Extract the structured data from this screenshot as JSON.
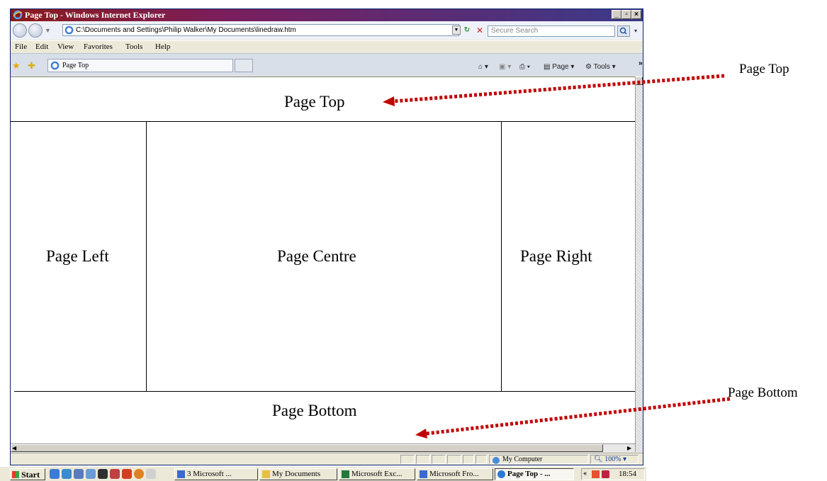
{
  "window": {
    "title": "Page Top - Windows Internet Explorer",
    "min": "_",
    "max": "▫",
    "close": "×"
  },
  "address": {
    "url": "C:\\Documents and Settings\\Philip Walker\\My Documents\\linedraw.htm",
    "search_placeholder": "Secure Search"
  },
  "menu": [
    "File",
    "Edit",
    "View",
    "Favorites",
    "Tools",
    "Help"
  ],
  "tab": {
    "label": "Page Top"
  },
  "commands": {
    "page": "Page ▾",
    "tools": "Tools ▾",
    "more": "»"
  },
  "page": {
    "top": "Page Top",
    "left": "Page Left",
    "centre": "Page Centre",
    "right": "Page Right",
    "bottom": "Page Bottom"
  },
  "status": {
    "zone": "My Computer",
    "zoom": "100%"
  },
  "taskbar": {
    "backtick": "`",
    "start": "Start",
    "buttons": [
      {
        "label": "3 Microsoft ...",
        "color": "#3a6ad0"
      },
      {
        "label": "My Documents",
        "color": "#e8c040"
      },
      {
        "label": "Microsoft Exc...",
        "color": "#1f7a3a"
      },
      {
        "label": "Microsoft Fro...",
        "color": "#3a6ad0"
      },
      {
        "label": "Page Top - ...",
        "color": "#2a7ad8"
      }
    ],
    "chevron": "«",
    "time": "18:54"
  },
  "annotations": {
    "top": "Page Top",
    "bottom": "Page Bottom"
  },
  "colors": {
    "arrow": "#c00000",
    "title_left": "#8b1a1a",
    "title_right": "#3a3a8a"
  }
}
